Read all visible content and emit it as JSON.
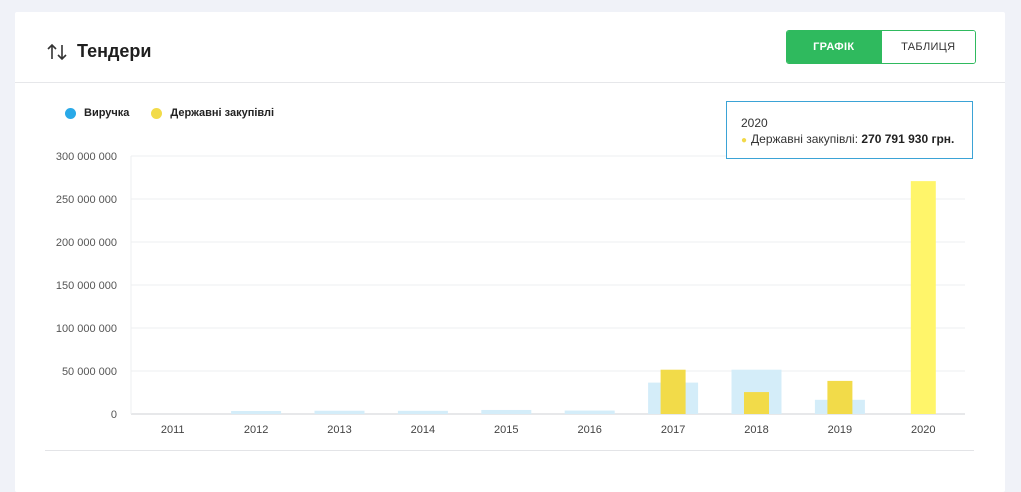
{
  "header": {
    "title": "Тендери",
    "toggle": {
      "chart_label": "ГРАФІК",
      "table_label": "ТАБЛИЦЯ"
    }
  },
  "colors": {
    "accent": "#2fba5e",
    "revenue": "#d4edf9",
    "revenue_dot": "#29a9e8",
    "procurement": "#f2db49",
    "procurement_highlight": "#fff56a"
  },
  "tooltip": {
    "year": "2020",
    "series": "Державні закупівлі",
    "value": "270 791 930 грн."
  },
  "chart_data": {
    "type": "bar",
    "categories": [
      "2011",
      "2012",
      "2013",
      "2014",
      "2015",
      "2016",
      "2017",
      "2018",
      "2019",
      "2020"
    ],
    "series": [
      {
        "name": "Виручка",
        "values": [
          0,
          3500000,
          3800000,
          3700000,
          4700000,
          4000000,
          36500000,
          51500000,
          16500000,
          0
        ]
      },
      {
        "name": "Державні закупівлі",
        "values": [
          0,
          0,
          0,
          0,
          0,
          0,
          51500000,
          25500000,
          38500000,
          270791930
        ]
      }
    ],
    "y_ticks": [
      "0",
      "50 000 000",
      "100 000 000",
      "150 000 000",
      "200 000 000",
      "250 000 000",
      "300 000 000"
    ],
    "ylim": [
      0,
      300000000
    ],
    "highlighted_category": "2020",
    "grid": true,
    "legend_position": "top-left"
  }
}
